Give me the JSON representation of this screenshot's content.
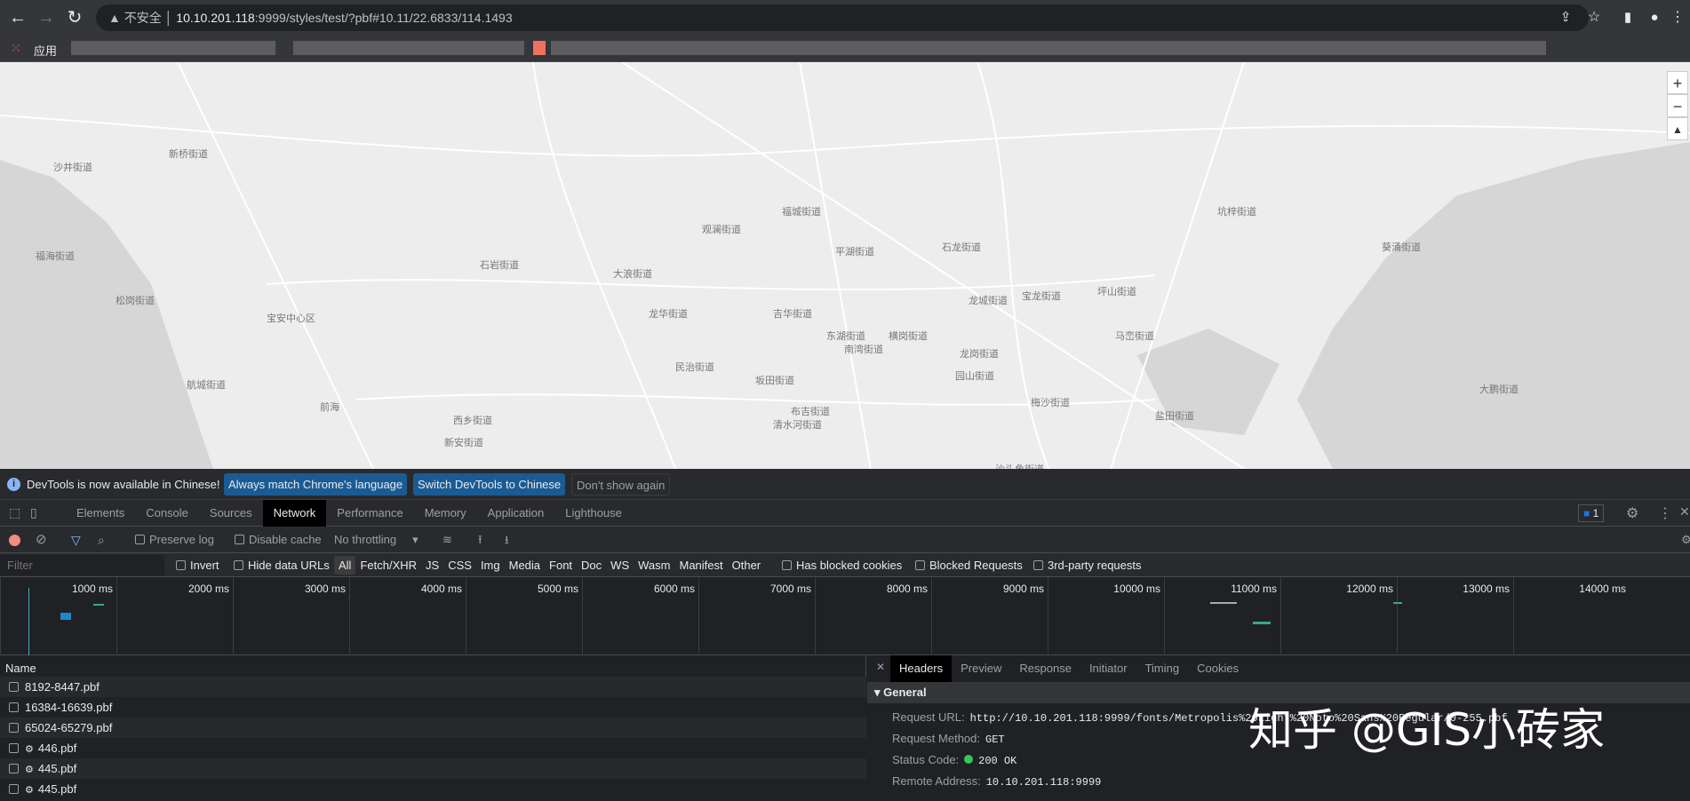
{
  "browser": {
    "security_label": "不安全",
    "url_host": "10.10.201.118",
    "url_rest": ":9999/styles/test/?pbf#10.11/22.6833/114.1493",
    "apps_label": "应用"
  },
  "map": {
    "labels": [
      "沙井街道",
      "福海街道",
      "新桥街道",
      "松岗街道",
      "石岩街道",
      "新安街道",
      "西乡街道",
      "航城街道",
      "民治街道",
      "龙华街道",
      "大浪街道",
      "观澜街道",
      "坂田街道",
      "布吉街道",
      "吉华街道",
      "平湖街道",
      "龙岗街道",
      "龙城街道",
      "坪山街道",
      "坑梓街道",
      "葵涌街道",
      "大鹏街道",
      "横岗街道",
      "园山街道",
      "宝龙街道",
      "马峦街道",
      "梅沙街道",
      "盐田街道",
      "东湖街道",
      "清水河街道",
      "南湾街道",
      "福城街道",
      "石龙街道",
      "沙头角街道",
      "前海",
      "宝安中心区"
    ],
    "zoom_in": "+",
    "zoom_out": "−",
    "compass": "▲"
  },
  "infobar": {
    "message": "DevTools is now available in Chinese!",
    "btn_match": "Always match Chrome's language",
    "btn_switch": "Switch DevTools to Chinese",
    "btn_dismiss": "Don't show again"
  },
  "tabs": [
    "Elements",
    "Console",
    "Sources",
    "Network",
    "Performance",
    "Memory",
    "Application",
    "Lighthouse"
  ],
  "issues_count": "1",
  "toolbar": {
    "preserve_log": "Preserve log",
    "disable_cache": "Disable cache",
    "throttling": "No throttling"
  },
  "filter": {
    "placeholder": "Filter",
    "invert": "Invert",
    "hide_data_urls": "Hide data URLs",
    "types": [
      "All",
      "Fetch/XHR",
      "JS",
      "CSS",
      "Img",
      "Media",
      "Font",
      "Doc",
      "WS",
      "Wasm",
      "Manifest",
      "Other"
    ],
    "blocked_cookies": "Has blocked cookies",
    "blocked_requests": "Blocked Requests",
    "third_party": "3rd-party requests"
  },
  "timeline": {
    "ticks": [
      "1000 ms",
      "2000 ms",
      "3000 ms",
      "4000 ms",
      "5000 ms",
      "6000 ms",
      "7000 ms",
      "8000 ms",
      "9000 ms",
      "10000 ms",
      "11000 ms",
      "12000 ms",
      "13000 ms",
      "14000 ms"
    ]
  },
  "requests": {
    "header": "Name",
    "rows": [
      {
        "name": "8192-8447.pbf",
        "gear": false
      },
      {
        "name": "16384-16639.pbf",
        "gear": false
      },
      {
        "name": "65024-65279.pbf",
        "gear": false
      },
      {
        "name": "446.pbf",
        "gear": true
      },
      {
        "name": "445.pbf",
        "gear": true
      },
      {
        "name": "445.pbf",
        "gear": true
      }
    ]
  },
  "details": {
    "tabs": [
      "Headers",
      "Preview",
      "Response",
      "Initiator",
      "Timing",
      "Cookies"
    ],
    "section": "General",
    "fields": [
      {
        "k": "Request URL:",
        "v": "http://10.10.201.118:9999/fonts/Metropolis%20Light%20Noto%20Sans%20Regular/0-255.pbf"
      },
      {
        "k": "Request Method:",
        "v": "GET"
      },
      {
        "k": "Status Code:",
        "v": "200 OK"
      },
      {
        "k": "Remote Address:",
        "v": "10.10.201.118:9999"
      }
    ]
  },
  "watermark": "知乎 @GIS小砖家"
}
